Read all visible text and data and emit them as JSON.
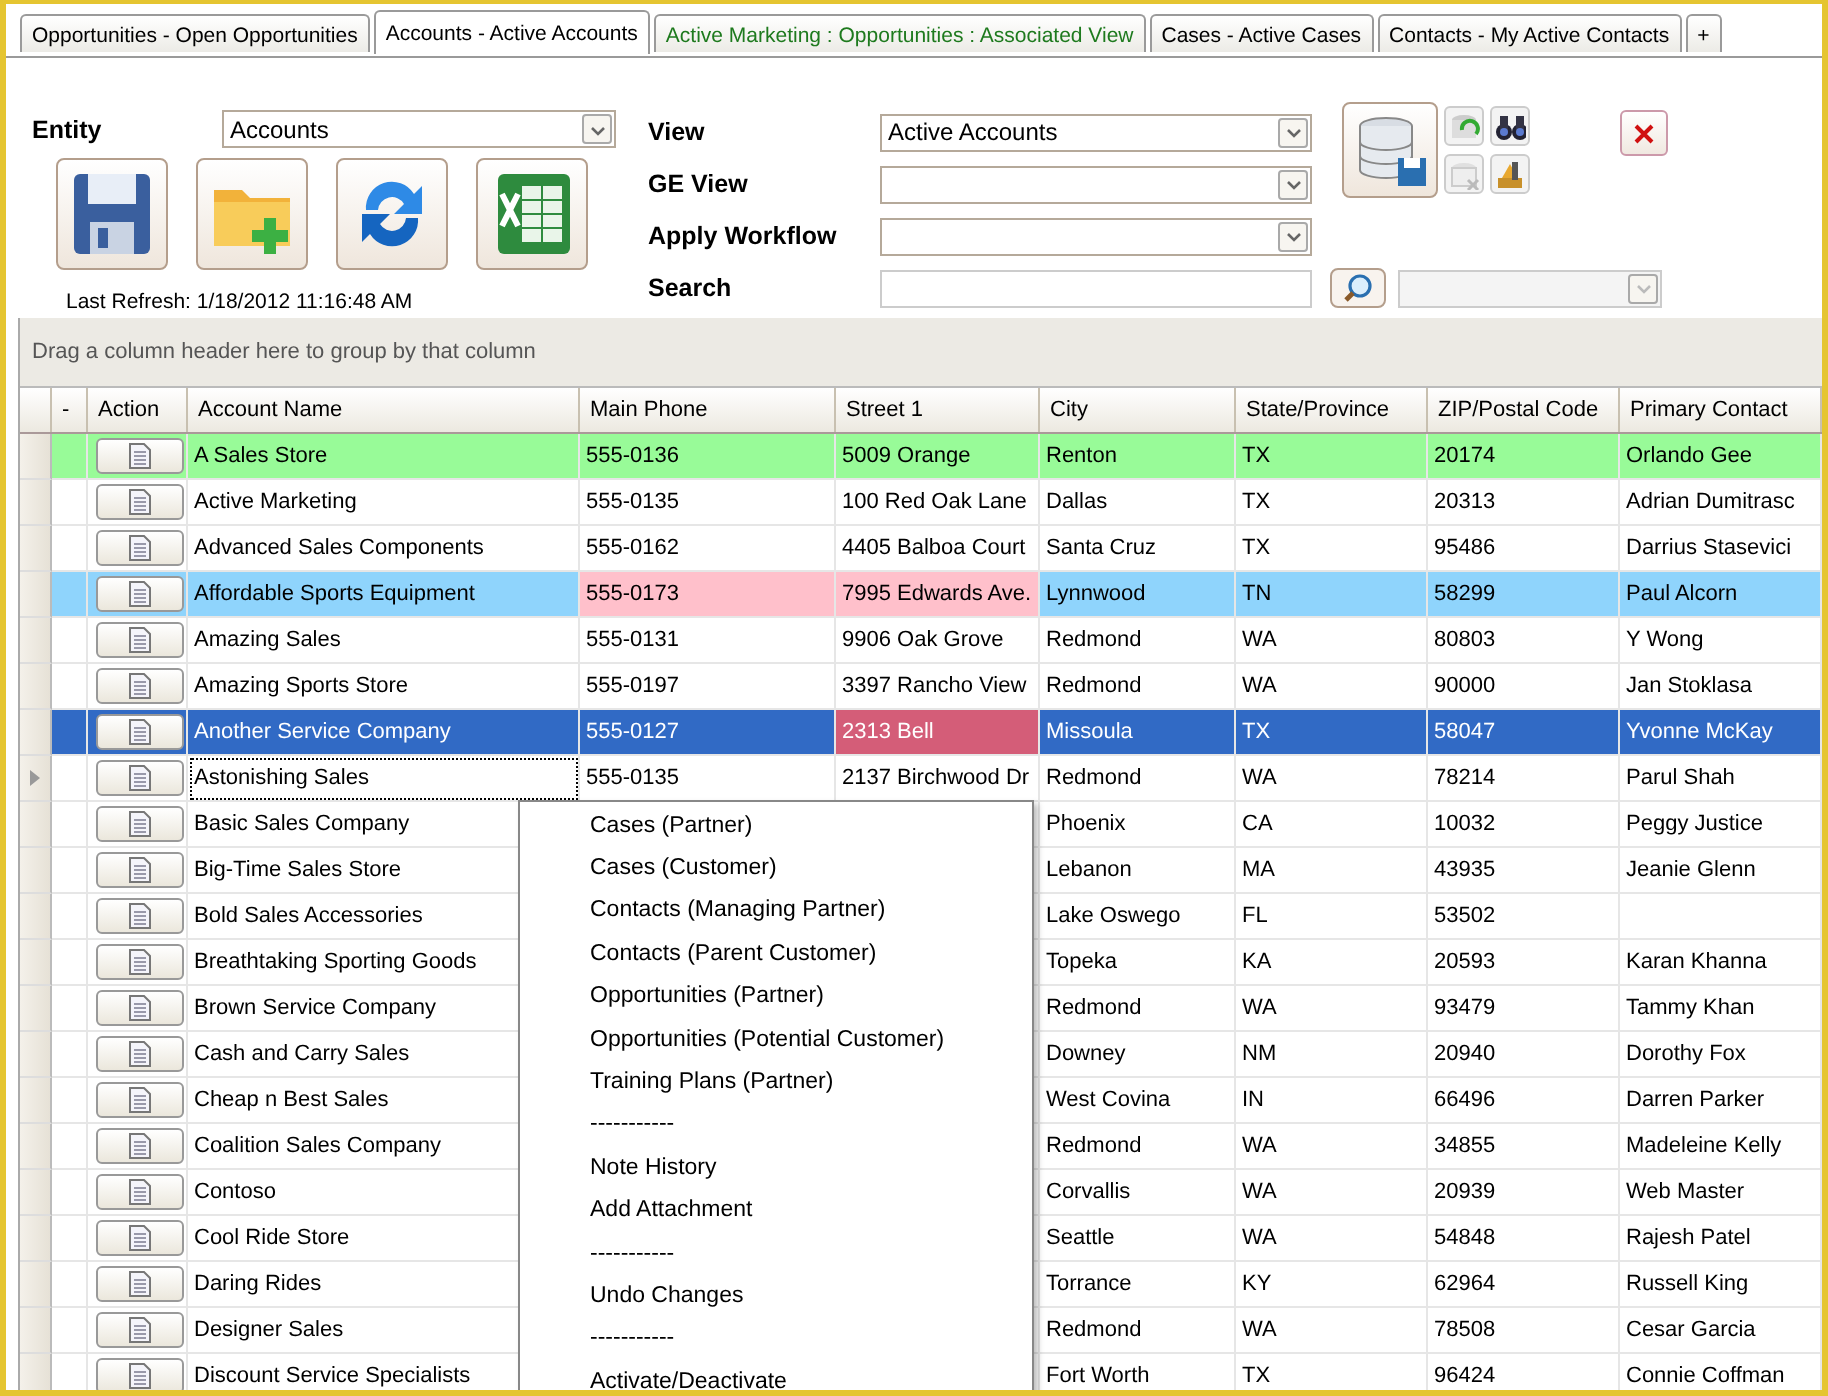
{
  "tabs": [
    {
      "label": "Opportunities - Open Opportunities",
      "selected": false,
      "color": "#000000"
    },
    {
      "label": "Accounts - Active Accounts",
      "selected": true,
      "color": "#000000"
    },
    {
      "label": "Active Marketing : Opportunities : Associated View",
      "selected": false,
      "color": "#1e7a1e"
    },
    {
      "label": "Cases - Active Cases",
      "selected": false,
      "color": "#000000"
    },
    {
      "label": "Contacts - My Active Contacts",
      "selected": false,
      "color": "#000000"
    },
    {
      "label": "+",
      "selected": false,
      "color": "#000000"
    }
  ],
  "toolbar": {
    "entity_label": "Entity",
    "entity_value": "Accounts",
    "last_refresh": "Last Refresh: 1/18/2012 11:16:48 AM",
    "view_label": "View",
    "view_value": "Active Accounts",
    "ge_view_label": "GE View",
    "apply_workflow_label": "Apply Workflow",
    "search_label": "Search",
    "search_scope_disabled": true
  },
  "group_panel": "Drag a column header here to group by that column",
  "columns": [
    "-",
    "Action",
    "Account Name",
    "Main Phone",
    "Street 1",
    "City",
    "State/Province",
    "ZIP/Postal Code",
    "Primary Contact"
  ],
  "rows": [
    {
      "name": "A Sales Store",
      "phone": "555-0136",
      "street": "5009 Orange",
      "city": "Renton",
      "state": "TX",
      "zip": "20174",
      "contact": "Orlando Gee",
      "color": "#98fb98",
      "selected": false,
      "current": false,
      "highlighted_phone": false,
      "highlighted_street": false
    },
    {
      "name": "Active Marketing",
      "phone": "555-0135",
      "street": "100 Red Oak Lane",
      "city": "Dallas",
      "state": "TX",
      "zip": "20313",
      "contact": "Adrian Dumitrasc",
      "color": "#ffffff",
      "selected": false,
      "current": false,
      "highlighted_phone": false,
      "highlighted_street": false
    },
    {
      "name": "Advanced Sales Components",
      "phone": "555-0162",
      "street": "4405 Balboa Court",
      "city": "Santa Cruz",
      "state": "TX",
      "zip": "95486",
      "contact": "Darrius Stasevici",
      "color": "#ffffff",
      "selected": false,
      "current": false,
      "highlighted_phone": false,
      "highlighted_street": false
    },
    {
      "name": "Affordable Sports Equipment",
      "phone": "555-0173",
      "street": "7995 Edwards Ave.",
      "city": "Lynnwood",
      "state": "TN",
      "zip": "58299",
      "contact": "Paul Alcorn",
      "color": "#8fd4fc",
      "selected": false,
      "current": false,
      "highlighted_phone": true,
      "highlighted_street": true
    },
    {
      "name": "Amazing Sales",
      "phone": "555-0131",
      "street": "9906 Oak Grove",
      "city": "Redmond",
      "state": "WA",
      "zip": "80803",
      "contact": "Y Wong",
      "color": "#ffffff",
      "selected": false,
      "current": false,
      "highlighted_phone": false,
      "highlighted_street": false
    },
    {
      "name": "Amazing Sports Store",
      "phone": "555-0197",
      "street": "3397 Rancho View",
      "city": "Redmond",
      "state": "WA",
      "zip": "90000",
      "contact": "Jan Stoklasa",
      "color": "#ffffff",
      "selected": false,
      "current": false,
      "highlighted_phone": false,
      "highlighted_street": false
    },
    {
      "name": "Another Service Company",
      "phone": "555-0127",
      "street": "2313 Bell",
      "city": "Missoula",
      "state": "TX",
      "zip": "58047",
      "contact": "Yvonne McKay",
      "color": "#316ac5",
      "selected": true,
      "current": false,
      "highlighted_phone": false,
      "highlighted_street": true
    },
    {
      "name": "Astonishing Sales",
      "phone": "555-0135",
      "street": "2137 Birchwood Dr",
      "city": "Redmond",
      "state": "WA",
      "zip": "78214",
      "contact": "Parul Shah",
      "color": "#ffffff",
      "selected": false,
      "current": true,
      "highlighted_phone": false,
      "highlighted_street": false
    },
    {
      "name": "Basic Sales Company",
      "city": "Phoenix",
      "state": "CA",
      "zip": "10032",
      "contact": "Peggy Justice",
      "color": "#ffffff",
      "selected": false,
      "current": false
    },
    {
      "name": "Big-Time Sales Store",
      "city": "Lebanon",
      "state": "MA",
      "zip": "43935",
      "contact": "Jeanie Glenn",
      "color": "#ffffff",
      "selected": false,
      "current": false
    },
    {
      "name": "Bold Sales Accessories",
      "city": "Lake Oswego",
      "state": "FL",
      "zip": "53502",
      "color": "#ffffff",
      "selected": false,
      "current": false
    },
    {
      "name": "Breathtaking Sporting Goods",
      "city": "Topeka",
      "state": "KA",
      "zip": "20593",
      "contact": "Karan Khanna",
      "color": "#ffffff",
      "selected": false,
      "current": false
    },
    {
      "name": "Brown Service Company",
      "city": "Redmond",
      "state": "WA",
      "zip": "93479",
      "contact": "Tammy Khan",
      "color": "#ffffff",
      "selected": false,
      "current": false
    },
    {
      "name": "Cash and Carry Sales",
      "city": "Downey",
      "state": "NM",
      "zip": "20940",
      "contact": "Dorothy Fox",
      "color": "#ffffff",
      "selected": false,
      "current": false
    },
    {
      "name": "Cheap n Best Sales",
      "city": "West Covina",
      "state": "IN",
      "zip": "66496",
      "contact": "Darren Parker",
      "color": "#ffffff",
      "selected": false,
      "current": false
    },
    {
      "name": "Coalition Sales Company",
      "city": "Redmond",
      "state": "WA",
      "zip": "34855",
      "contact": "Madeleine Kelly",
      "color": "#ffffff",
      "selected": false,
      "current": false
    },
    {
      "name": "Contoso",
      "city": "Corvallis",
      "state": "WA",
      "zip": "20939",
      "contact": "Web Master",
      "color": "#ffffff",
      "selected": false,
      "current": false
    },
    {
      "name": "Cool Ride Store",
      "city": "Seattle",
      "state": "WA",
      "zip": "54848",
      "contact": "Rajesh Patel",
      "color": "#ffffff",
      "selected": false,
      "current": false
    },
    {
      "name": "Daring Rides",
      "city": "Torrance",
      "state": "KY",
      "zip": "62964",
      "contact": "Russell King",
      "color": "#ffffff",
      "selected": false,
      "current": false
    },
    {
      "name": "Designer Sales",
      "city": "Redmond",
      "state": "WA",
      "zip": "78508",
      "contact": "Cesar Garcia",
      "color": "#ffffff",
      "selected": false,
      "current": false
    },
    {
      "name": "Discount Service Specialists",
      "city": "Fort Worth",
      "state": "TX",
      "zip": "96424",
      "contact": "Connie Coffman",
      "color": "#ffffff",
      "selected": false,
      "current": false
    }
  ],
  "context_menu": [
    "Cases (Partner)",
    "Cases (Customer)",
    "Contacts (Managing Partner)",
    "Contacts (Parent Customer)",
    "Opportunities (Partner)",
    "Opportunities (Potential Customer)",
    "Training Plans (Partner)",
    "-----------",
    "Note History",
    "Add Attachment",
    "-----------",
    "Undo Changes",
    "-----------",
    "Activate/Deactivate"
  ]
}
